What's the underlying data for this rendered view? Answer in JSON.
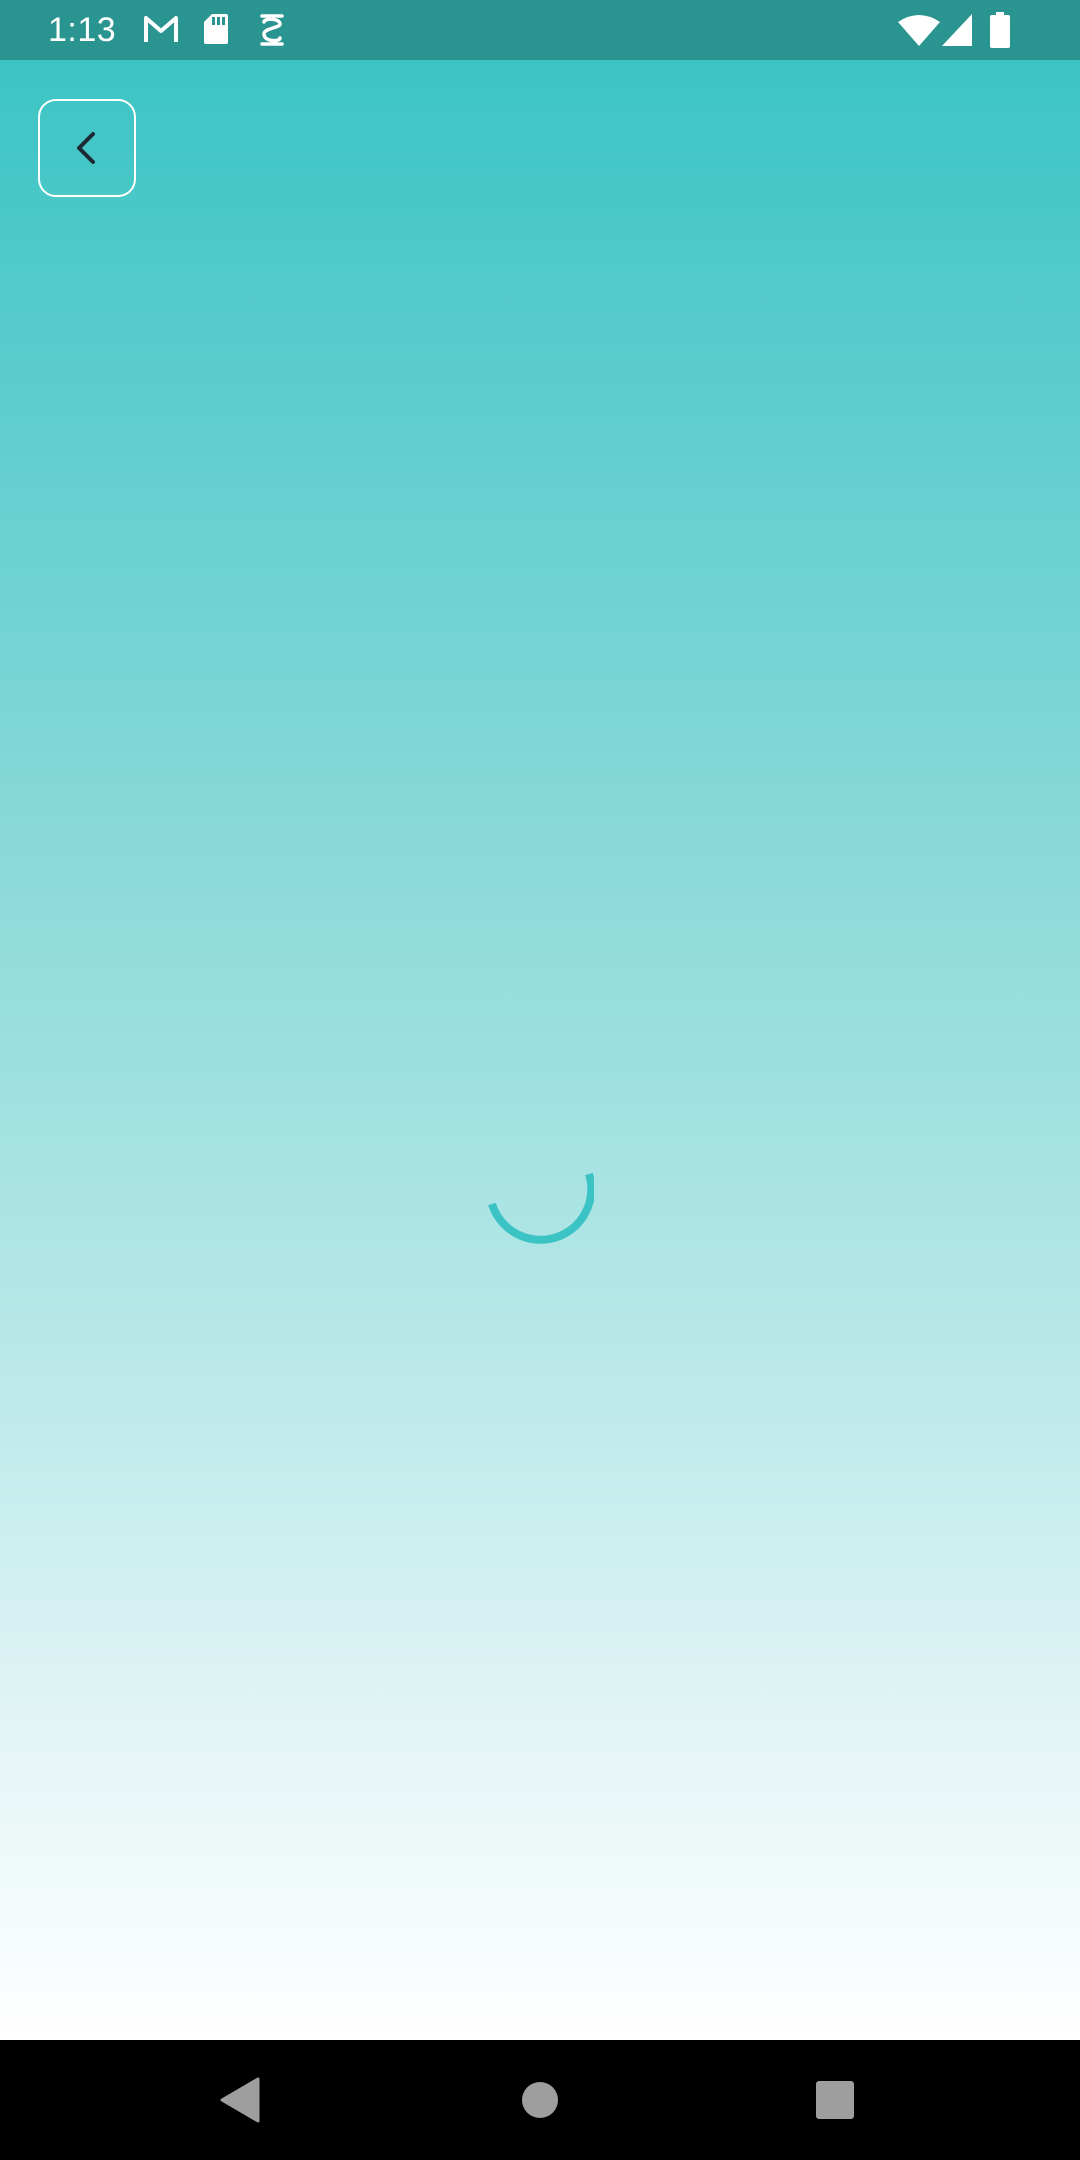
{
  "status_bar": {
    "time": "1:13",
    "left_icons": [
      "gmail-icon",
      "sd-card-icon",
      "sync-icon"
    ],
    "right_icons": [
      "wifi-icon",
      "signal-icon",
      "battery-icon"
    ],
    "background": "#2a9490"
  },
  "screen": {
    "back_button_icon": "chevron-left-icon",
    "loading": true,
    "gradient_top": "#3cc4c4",
    "gradient_bottom": "#ffffff",
    "spinner_color": "#3cc4c4"
  },
  "nav_bar": {
    "buttons": [
      "back-nav-icon",
      "home-nav-icon",
      "recents-nav-icon"
    ]
  }
}
